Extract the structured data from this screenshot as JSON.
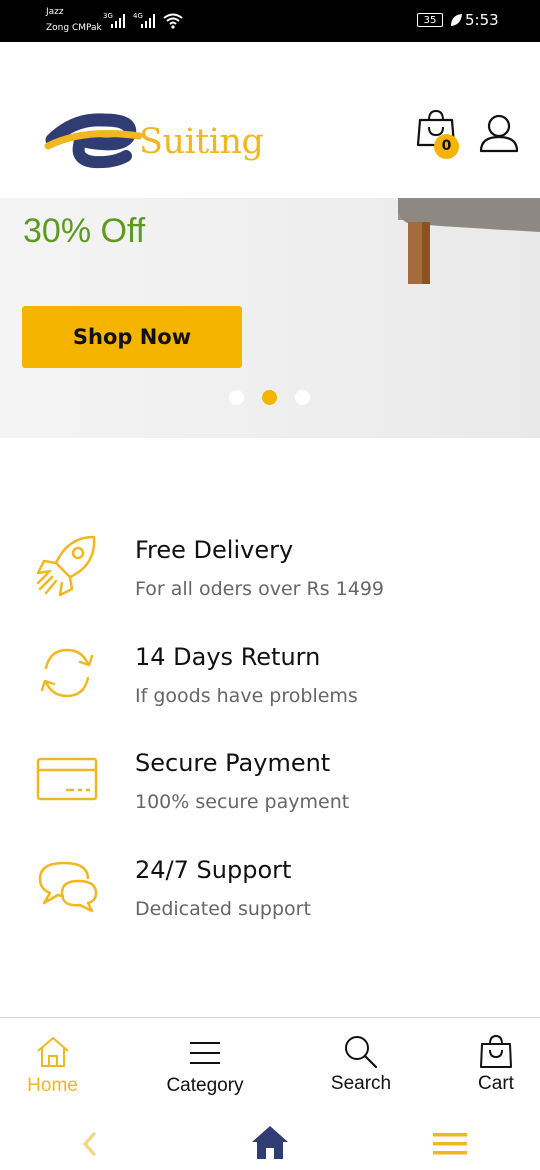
{
  "status_bar": {
    "carrier_1": "Jazz",
    "carrier_2": "Zong CMPak",
    "network_1": "3G",
    "network_2": "4G",
    "battery": "35",
    "time": "5:53"
  },
  "header": {
    "logo_text": "Suiting",
    "cart_count": "0",
    "brand_color": "#f0b722",
    "logo_blue": "#2f3d73"
  },
  "banner": {
    "offer_text": "30% Off",
    "shop_button_label": "Shop Now",
    "slides_count": 3,
    "active_slide": 2
  },
  "features": [
    {
      "icon": "rocket-icon",
      "title": "Free Delivery",
      "subtitle": "For all oders over Rs 1499"
    },
    {
      "icon": "refresh-icon",
      "title": "14 Days Return",
      "subtitle": "If goods have problems"
    },
    {
      "icon": "credit-card-icon",
      "title": "Secure Payment",
      "subtitle": "100% secure payment"
    },
    {
      "icon": "chat-icon",
      "title": "24/7 Support",
      "subtitle": "Dedicated support"
    }
  ],
  "bottom_nav": {
    "items": [
      {
        "label": "Home",
        "icon": "home-icon",
        "active": true
      },
      {
        "label": "Category",
        "icon": "menu-icon",
        "active": false
      },
      {
        "label": "Search",
        "icon": "search-icon",
        "active": false
      },
      {
        "label": "Cart",
        "icon": "bag-icon",
        "active": false
      }
    ],
    "active_color": "#f0b722"
  },
  "system_nav": {
    "back_icon": "chevron-left-icon",
    "home_icon": "home-filled-icon",
    "menu_icon": "hamburger-icon"
  }
}
